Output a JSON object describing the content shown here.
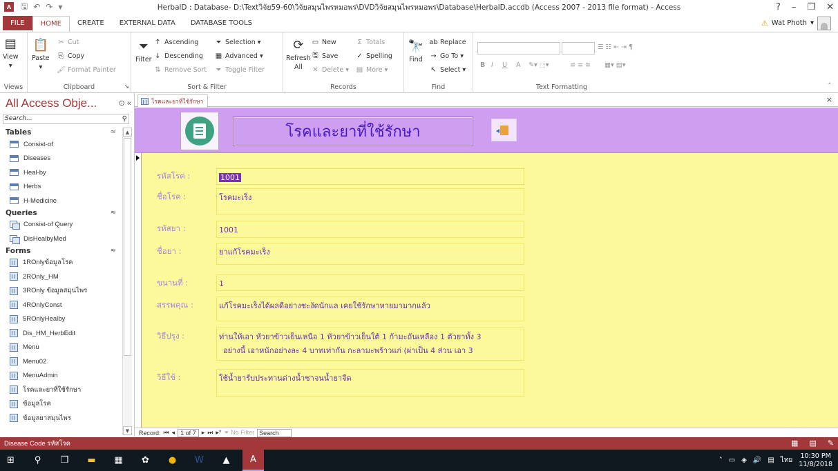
{
  "window": {
    "title": "HerbalD : Database- D:\\Textวิจัย59-60\\วิจัยสมุนไพรหมอพร\\DVDวิจัยสมุนไพรหมอพร\\Database\\HerbalD.accdb (Access 2007 - 2013 file format) - Access",
    "app_icon": "A",
    "help": "?",
    "minimize": "–",
    "restore": "❐",
    "close": "✕"
  },
  "ribbon_tabs": [
    "FILE",
    "HOME",
    "CREATE",
    "EXTERNAL DATA",
    "DATABASE TOOLS"
  ],
  "user": {
    "name": "Wat Photh",
    "warning_icon": "warning-icon"
  },
  "ribbon": {
    "views": {
      "view": "View",
      "label": "Views"
    },
    "clipboard": {
      "paste": "Paste",
      "cut": "Cut",
      "copy": "Copy",
      "format_painter": "Format Painter",
      "label": "Clipboard"
    },
    "sort_filter": {
      "filter": "Filter",
      "ascending": "Ascending",
      "descending": "Descending",
      "remove_sort": "Remove Sort",
      "selection": "Selection",
      "advanced": "Advanced",
      "toggle_filter": "Toggle Filter",
      "label": "Sort & Filter"
    },
    "records": {
      "refresh": "Refresh",
      "refresh_all": "All",
      "new": "New",
      "save": "Save",
      "delete": "Delete",
      "totals": "Totals",
      "spelling": "Spelling",
      "more": "More",
      "label": "Records"
    },
    "find": {
      "find": "Find",
      "replace": "Replace",
      "goto": "Go To",
      "select": "Select",
      "label": "Find"
    },
    "text_formatting": {
      "label": "Text Formatting",
      "bold": "B",
      "italic": "I",
      "underline": "U",
      "font_color": "A"
    }
  },
  "nav": {
    "title": "All Access Obje...",
    "search_placeholder": "Search...",
    "sections": [
      {
        "name": "Tables",
        "items": [
          "Consist-of",
          "Diseases",
          "Heal-by",
          "Herbs",
          "H-Medicine"
        ]
      },
      {
        "name": "Queries",
        "items": [
          "Consist-of Query",
          "DisHealbyMed"
        ]
      },
      {
        "name": "Forms",
        "items": [
          "1ROnlyข้อมูลโรค",
          "2ROnly_HM",
          "3ROnly ข้อมูลสมุนไพร",
          "4ROnlyConst",
          "5ROnlyHealby",
          "Dis_HM_HerbEdit",
          "Menu",
          "Menu02",
          "MenuAdmin",
          "โรคและยาที่ใช้รักษา",
          "ข้อมูลโรค",
          "ข้อมูลยาสมุนไพร"
        ]
      }
    ]
  },
  "doc_tab": {
    "label": "โรคและยาที่ใช้รักษา",
    "close": "×"
  },
  "form": {
    "title": "โรคและยาที่ใช้รักษา",
    "fields": [
      {
        "label": "รหัสโรค :",
        "value": "1001"
      },
      {
        "label": "ชื่อโรค :",
        "value": "โรคมะเร็ง"
      },
      {
        "label": "รหัสยา :",
        "value": "1001"
      },
      {
        "label": "ชื่อยา :",
        "value": "ยาแก้โรคมะเร็ง"
      },
      {
        "label": "ขนานที่ :",
        "value": "1"
      },
      {
        "label": "สรรพคุณ :",
        "value": "แก้โรคมะเร็งได้ผลดีอย่างชะงัดนักแล เคยใช้รักษาหายมามากแล้ว"
      },
      {
        "label": "วิธีปรุง :",
        "value": "ท่านให้เอา หัวยาข้าวเย็นเหนือ 1 หัวยาข้าวเย็นใต้ 1 ก้ามะถันเหลือง 1 ตัวยาทั้ง 3",
        "value2": "อย่างนี้ เอาหนักอย่างละ 4 บาทเท่ากัน กะลามะพร้าวแก่ (ผ่าเป็น 4 ส่วน เอา 3"
      },
      {
        "label": "วิธีใช้ :",
        "value": "ใช้น้ำยารับประทานต่างน้ำชาจนน้ำยาจืด"
      }
    ]
  },
  "record_nav": {
    "record_label": "Record:",
    "position": "1 of 7",
    "no_filter": "No Filter",
    "search": "Search"
  },
  "status": {
    "text": "Disease Code รหัสโรค"
  },
  "taskbar": {
    "time": "10:30 PM",
    "date": "11/8/2018",
    "lang": "ไทย"
  }
}
